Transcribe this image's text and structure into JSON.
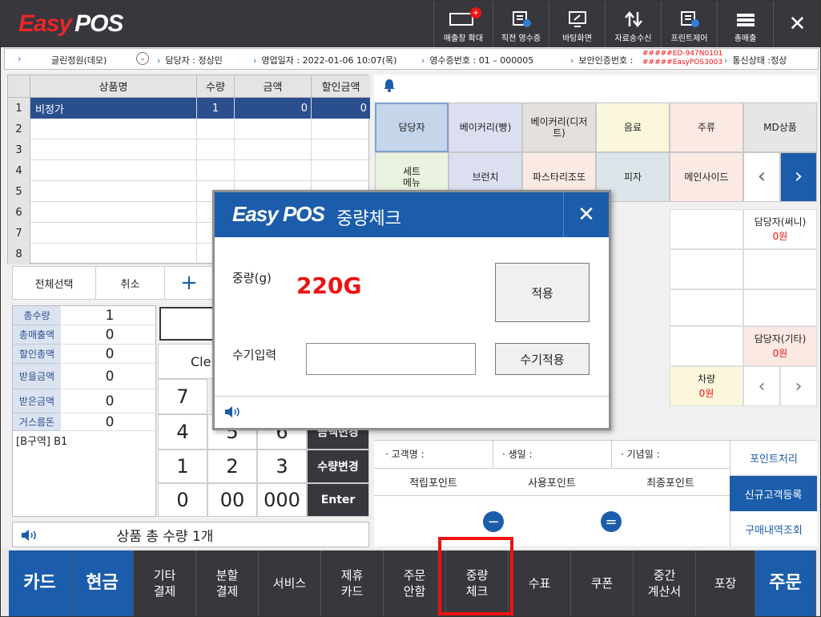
{
  "app": {
    "logo_easy": "Easy",
    "logo_pos": "POS"
  },
  "toolbar": {
    "items": [
      {
        "label": "매출창 확대",
        "icon": "expand-window-icon"
      },
      {
        "label": "직전 영수증",
        "icon": "receipt-icon"
      },
      {
        "label": "바탕화면",
        "icon": "desktop-icon"
      },
      {
        "label": "자료송수신",
        "icon": "transfer-icon"
      },
      {
        "label": "프린트제어",
        "icon": "printer-icon"
      },
      {
        "label": "총매출",
        "icon": "total-sales-icon"
      }
    ],
    "close_icon": "✕"
  },
  "infobar": {
    "store": "글린정원(데모)",
    "staff": "담당자 : 정상민",
    "business_date": "영업일자 :  2022-01-06 10:07(목)",
    "receipt_no": "영수증번호 :  01 –  000005",
    "security_label": "보안인증번호 :",
    "security_line1": "#####ED-947N0101",
    "security_line2": "#####EasyPOS3003",
    "comm_status": "통신상태 :정상"
  },
  "grid": {
    "headers": [
      "상품명",
      "수량",
      "금액",
      "할인금액"
    ],
    "rows": [
      {
        "no": "1",
        "name": "비정가",
        "qty": "1",
        "amount": "0",
        "discount": "0"
      },
      {
        "no": "2",
        "name": "",
        "qty": "",
        "amount": "",
        "discount": ""
      },
      {
        "no": "3",
        "name": "",
        "qty": "",
        "amount": "",
        "discount": ""
      },
      {
        "no": "4",
        "name": "",
        "qty": "",
        "amount": "",
        "discount": ""
      },
      {
        "no": "5",
        "name": "",
        "qty": "",
        "amount": "",
        "discount": ""
      },
      {
        "no": "6",
        "name": "",
        "qty": "",
        "amount": "",
        "discount": ""
      },
      {
        "no": "7",
        "name": "",
        "qty": "",
        "amount": "",
        "discount": ""
      },
      {
        "no": "8",
        "name": "",
        "qty": "",
        "amount": "",
        "discount": ""
      }
    ]
  },
  "actions": {
    "select_all": "전체선택",
    "cancel": "취소",
    "plus": "+"
  },
  "totals": [
    {
      "label": "총수량",
      "value": "1"
    },
    {
      "label": "총매출액",
      "value": "0"
    },
    {
      "label": "할인총액",
      "value": "0"
    },
    {
      "label": "받을금액",
      "value": "0"
    },
    {
      "label": "받은금액",
      "value": "0"
    },
    {
      "label": "거스름돈",
      "value": "0"
    }
  ],
  "zone": "[B구역] B1",
  "keypad": {
    "clear": "Cle",
    "keys": [
      "7",
      "4",
      "5",
      "6",
      "1",
      "2",
      "3",
      "0",
      "00",
      "000"
    ],
    "price_change": "금액변경",
    "qty_change": "수량변경",
    "enter": "Enter"
  },
  "status_bar": {
    "text": "상품 총 수량 1개"
  },
  "categories": {
    "row1": [
      "담당자",
      "베이커리(빵)",
      "베이커리(디저트)",
      "음료",
      "주류",
      "MD상품"
    ],
    "row2": [
      "세트\n메뉴",
      "브런치",
      "파스타리조또",
      "피자",
      "메인사이드"
    ]
  },
  "slots": {
    "staff_sunny": {
      "name": "담당자(써니)",
      "price": "0원"
    },
    "staff_etc": {
      "name": "담당자(기타)",
      "price": "0원"
    },
    "tea": {
      "name": "차량",
      "price": "0원"
    }
  },
  "customer": {
    "name_label": "· 고객명 :",
    "birthday_label": "· 생일 :",
    "anniversary_label": "· 기념일 :",
    "earned_points": "적립포인트",
    "used_points": "사용포인트",
    "final_points": "최종포인트",
    "minus": "−",
    "equals": "=",
    "point_process": "포인트처리",
    "new_customer": "신규고객등록",
    "purchase_history": "구매내역조회"
  },
  "bottom": [
    "카드",
    "현금",
    "기타\n결제",
    "분할\n결제",
    "서비스",
    "제휴\n카드",
    "주문\n안함",
    "중량\n체크",
    "수표",
    "쿠폰",
    "중간\n계산서",
    "포장",
    "주문"
  ],
  "dialog": {
    "logo": "Easy POS",
    "title": "중량체크",
    "weight_label": "중량(g)",
    "weight_value": "220G",
    "apply": "적용",
    "manual_label": "수기입력",
    "manual_value": "",
    "manual_apply": "수기적용"
  },
  "colors": {
    "brand_blue": "#1b5dab",
    "dark": "#37373d",
    "alert_red": "#e11111"
  }
}
